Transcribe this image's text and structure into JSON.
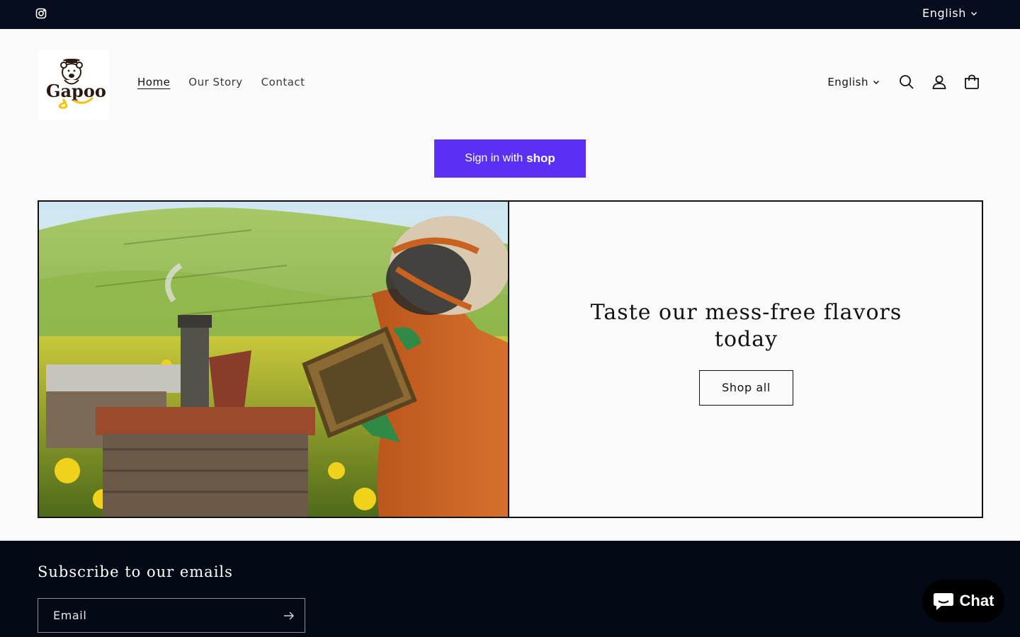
{
  "topbar": {
    "social_icon": "instagram-icon",
    "language": "English"
  },
  "header": {
    "logo_text": "Gapoo",
    "nav": [
      "Home",
      "Our Story",
      "Contact"
    ],
    "active_nav": "Home",
    "language": "English",
    "icons": [
      "search-icon",
      "account-icon",
      "cart-icon"
    ]
  },
  "shop_signin": {
    "prefix": "Sign in with",
    "brand": "shop",
    "color": "#5a31f4"
  },
  "banner": {
    "heading": "Taste our mess-free flavors today",
    "button": "Shop all",
    "image_alt": "beekeeper-in-rapeseed-field-image"
  },
  "footer": {
    "heading": "Subscribe to our emails",
    "email_placeholder": "Email"
  },
  "chat": {
    "label": "Chat"
  },
  "colors": {
    "dark": "#060d1e",
    "background": "#fafafa",
    "text": "#121212"
  }
}
